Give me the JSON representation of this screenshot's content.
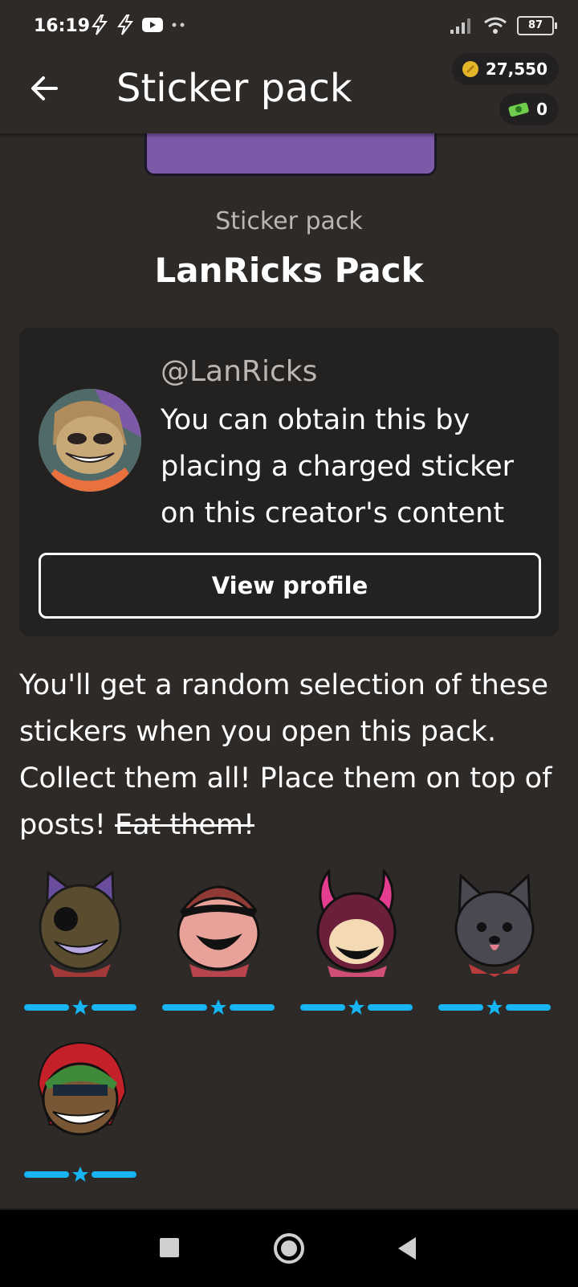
{
  "status_bar": {
    "time": "16:19",
    "battery": "87"
  },
  "app_bar": {
    "title": "Sticker pack",
    "coins": "27,550",
    "cash": "0"
  },
  "pack": {
    "subtitle": "Sticker pack",
    "title": "LanRicks Pack"
  },
  "creator": {
    "handle": "@LanRicks",
    "description": "You can obtain this by placing a charged sticker on this creator's content",
    "view_profile_label": "View profile"
  },
  "info": {
    "text": "You'll get a random selection of these stickers when you open this pack. Collect them all! Place them on top of posts!",
    "struck_text": "Eat them!"
  },
  "stickers": [
    {
      "name": "purple-cat-ear-character",
      "rarity": "common"
    },
    {
      "name": "beanie-character",
      "rarity": "common"
    },
    {
      "name": "horned-character",
      "rarity": "common"
    },
    {
      "name": "grey-cat",
      "rarity": "common"
    },
    {
      "name": "green-hair-braces-character",
      "rarity": "common"
    }
  ],
  "colors": {
    "background": "#2d2a28",
    "card": "#242221",
    "rarity_blue": "#17b6f2",
    "banner_purple": "#7d5aa8"
  }
}
